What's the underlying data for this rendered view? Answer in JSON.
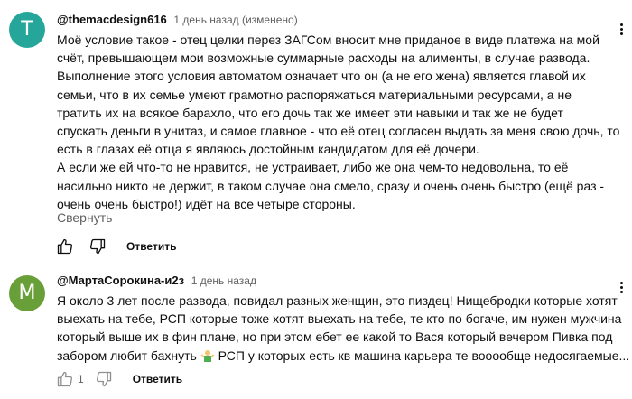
{
  "comments": [
    {
      "avatar_letter": "T",
      "avatar_color": "#26a69a",
      "author": "@themacdesign616",
      "meta": "1 день назад (изменено)",
      "lines": [
        "Моё условие такое - отец целки перез ЗАГСом вносит мне приданое  в виде платежа на мой",
        "счёт, превышающем мои возможные суммарные расходы на алименты, в случае развода.",
        "Выполнение этого условия автоматом означает что он (а не его жена) является главой их",
        "семьи, что в их семье умеют грамотно распоряжаться материальными ресурсами, а не",
        "тратить их на всякое барахло, что его дочь так же имеет эти навыки и так же не будет",
        "спускать деньги в унитаз, и самое главное - что её отец согласен выдать за меня свою дочь, то",
        "есть в глазах её отца я являюсь достойным кандидатом для её дочери.",
        "А если же ей что-то не нравится, не устраивает, либо же она чем-то недовольна, то её",
        "насильно никто не держит, в таком случае она смело, сразу и очень очень быстро (ещё раз -",
        "очень очень быстро!) идёт на все четыре стороны."
      ],
      "collapse_label": "Свернуть",
      "like_count": "",
      "reply_label": "Ответить"
    },
    {
      "avatar_letter": "M",
      "avatar_color": "#689f38",
      "author": "@МартаСорокина-и2з",
      "meta": "1 день назад",
      "lines": [
        "Я около 3 лет после развода, повидал разных женщин, это пиздец! Нищебродки которые хотят",
        "выехать на тебе, РСП которые тоже хотят выехать на тебе, те кто по богаче, им нужен мужчина",
        "который выше их в фин плане, но при этом ебет ее какой то Вася который вечером Пивка под",
        "забором любит бахнуть",
        " РСП у которых есть кв машина карьера  те вооообще недосягаемые..."
      ],
      "like_count": "1",
      "reply_label": "Ответить"
    }
  ],
  "icons": {
    "like": "thumbs-up-icon",
    "dislike": "thumbs-down-icon",
    "more": "vertical-dots-icon",
    "emoji": "person-shrugging-emoji"
  }
}
